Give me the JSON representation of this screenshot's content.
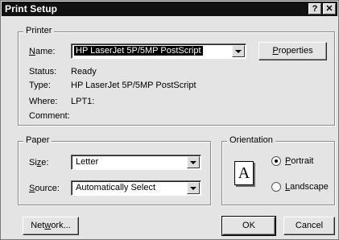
{
  "window": {
    "title": "Print Setup",
    "help_glyph": "?",
    "close_glyph": "✕"
  },
  "printer": {
    "legend": "Printer",
    "name_label": "Name:",
    "name_value": "HP LaserJet 5P/5MP PostScript",
    "properties_label": "Properties",
    "status_label": "Status:",
    "status_value": "Ready",
    "type_label": "Type:",
    "type_value": "HP LaserJet 5P/5MP PostScript",
    "where_label": "Where:",
    "where_value": "LPT1:",
    "comment_label": "Comment:",
    "comment_value": ""
  },
  "paper": {
    "legend": "Paper",
    "size_label": "Size:",
    "size_value": "Letter",
    "source_label": "Source:",
    "source_value": "Automatically Select"
  },
  "orientation": {
    "legend": "Orientation",
    "icon_letter": "A",
    "portrait_label": "Portrait",
    "landscape_label": "Landscape",
    "selected": "Portrait"
  },
  "buttons": {
    "network": "Network...",
    "ok": "OK",
    "cancel": "Cancel"
  }
}
